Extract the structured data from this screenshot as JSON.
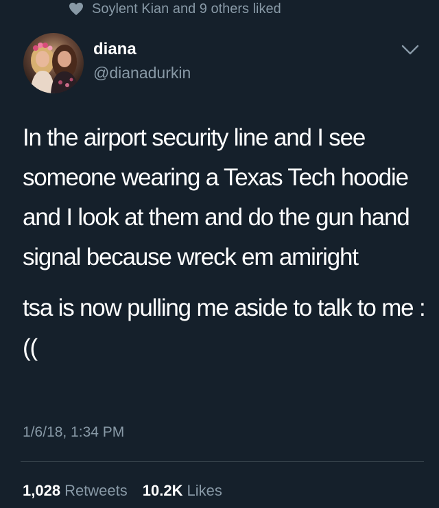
{
  "social_context": {
    "icon": "heart-icon",
    "text": "Soylent Kian and 9 others liked"
  },
  "author": {
    "display_name": "diana",
    "handle": "@dianadurkin"
  },
  "tweet": {
    "paragraphs": [
      "In the airport security line and I see someone wearing a Texas Tech hoodie and I look at them and do the gun hand signal because wreck em amiright",
      "tsa is now pulling me aside to talk to me :(("
    ],
    "timestamp": "1/6/18, 1:34 PM"
  },
  "stats": {
    "retweets_count": "1,028",
    "retweets_label": "Retweets",
    "likes_count": "10.2K",
    "likes_label": "Likes"
  },
  "colors": {
    "background": "#15202b",
    "secondary_text": "#8899a6",
    "divider": "#38444d"
  }
}
